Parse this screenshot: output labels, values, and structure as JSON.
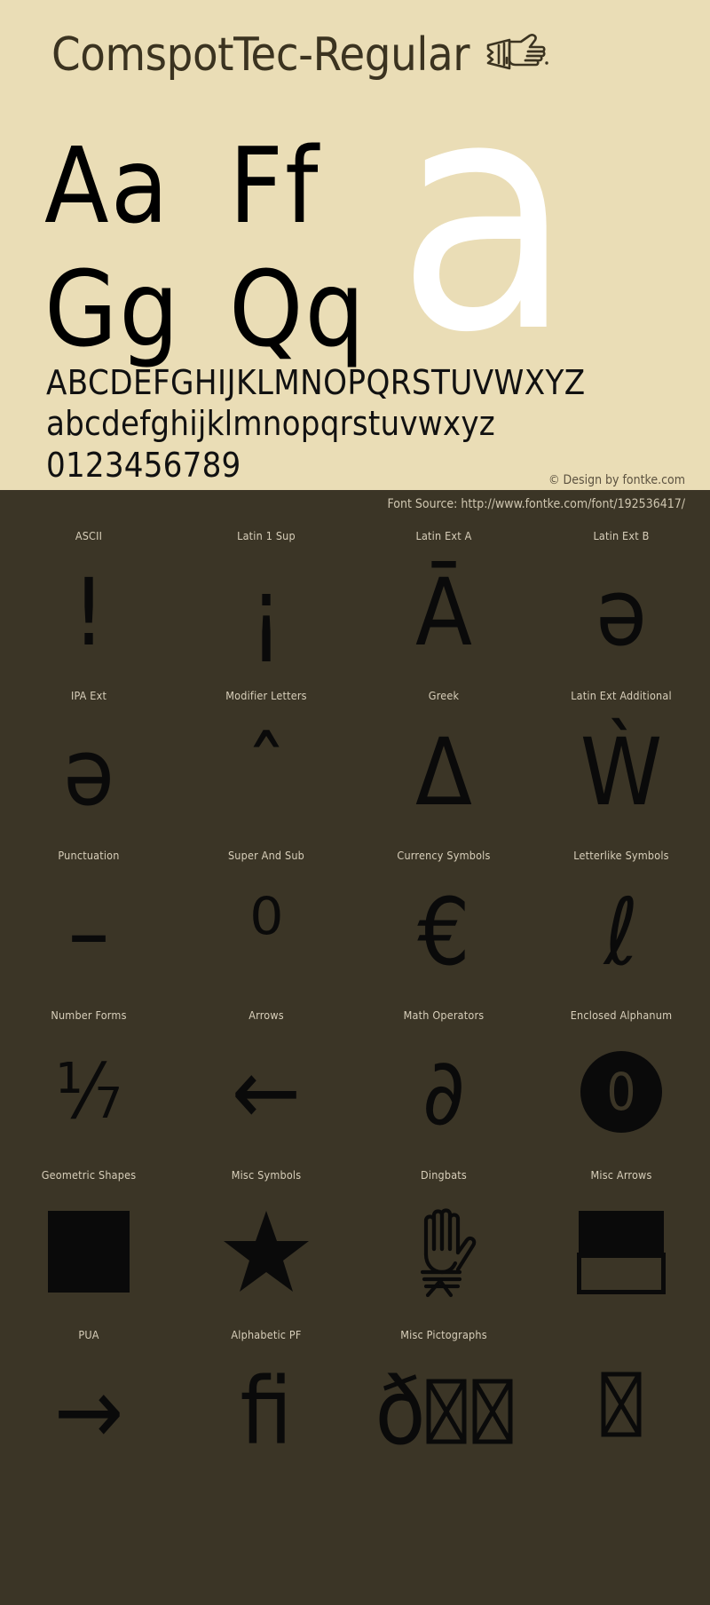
{
  "header": {
    "title": "ComspotTec-Regular",
    "title_glyph_icon": "pointing-hand-icon"
  },
  "specimen": {
    "big_letter": "a",
    "letter_pairs": [
      [
        "Aa",
        "Ff"
      ],
      [
        "Gg",
        "Qq"
      ]
    ],
    "uppercase": "ABCDEFGHIJKLMNOPQRSTUVWXYZ",
    "lowercase": "abcdefghijklmnopqrstuvwxyz",
    "digits": "0123456789",
    "credit": "© Design by fontke.com"
  },
  "footer": {
    "source": "Font Source: http://www.fontke.com/font/192536417/"
  },
  "colors": {
    "light_background": "#eaddb6",
    "dark_background": "#3b3526",
    "title_text": "#3b3320",
    "glyph_black": "#0a0a0a",
    "big_letter_white": "#ffffff",
    "label_text": "#d8cfba"
  },
  "glyph_blocks": [
    {
      "label": "ASCII",
      "glyph": "!",
      "icon": "exclamation-glyph"
    },
    {
      "label": "Latin 1 Sup",
      "glyph": "¡",
      "icon": "inverted-exclamation-glyph"
    },
    {
      "label": "Latin Ext A",
      "glyph": "Ā",
      "icon": "a-macron-glyph"
    },
    {
      "label": "Latin Ext B",
      "glyph": "ə",
      "icon": "schwa-glyph"
    },
    {
      "label": "IPA Ext",
      "glyph": "ə",
      "icon": "schwa-glyph"
    },
    {
      "label": "Modifier Letters",
      "glyph": "ˆ",
      "icon": "modifier-circumflex-glyph"
    },
    {
      "label": "Greek",
      "glyph": "Δ",
      "icon": "delta-glyph"
    },
    {
      "label": "Latin Ext Additional",
      "glyph": "Ẁ",
      "icon": "w-grave-glyph"
    },
    {
      "label": "Punctuation",
      "glyph": "–",
      "icon": "en-dash-glyph"
    },
    {
      "label": "Super And Sub",
      "glyph": "⁰",
      "icon": "superscript-zero-glyph"
    },
    {
      "label": "Currency Symbols",
      "glyph": "€",
      "icon": "euro-glyph"
    },
    {
      "label": "Letterlike Symbols",
      "glyph": "ℓ",
      "icon": "script-l-glyph"
    },
    {
      "label": "Number Forms",
      "glyph": "⅐",
      "icon": "one-seventh-fraction-glyph"
    },
    {
      "label": "Arrows",
      "glyph": "←",
      "icon": "left-arrow-glyph"
    },
    {
      "label": "Math Operators",
      "glyph": "∂",
      "icon": "partial-differential-glyph"
    },
    {
      "label": "Enclosed Alphanum",
      "glyph": "⓿",
      "icon": "circled-zero-glyph"
    },
    {
      "label": "Geometric Shapes",
      "glyph": "■",
      "icon": "filled-square-glyph"
    },
    {
      "label": "Misc Symbols",
      "glyph": "★",
      "icon": "filled-star-glyph"
    },
    {
      "label": "Dingbats",
      "glyph": "",
      "icon": "raised-hand-glyph"
    },
    {
      "label": "Misc Arrows",
      "glyph": "",
      "icon": "rectangle-divided-glyph"
    },
    {
      "label": "PUA",
      "glyph": "→",
      "icon": "right-arrow-glyph"
    },
    {
      "label": "Alphabetic PF",
      "glyph": "ﬁ",
      "icon": "fi-ligature-glyph"
    },
    {
      "label": "Misc Pictographs",
      "glyph": "ð",
      "icon": "eth-glyph"
    },
    {
      "label": "",
      "glyph": "",
      "icon": "tofu-box-glyph"
    }
  ]
}
